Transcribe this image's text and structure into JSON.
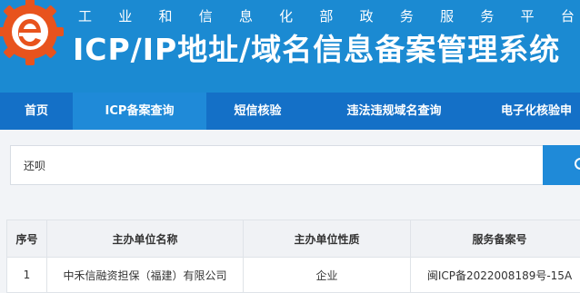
{
  "header": {
    "platform_name": [
      "工",
      "业",
      "和",
      "信",
      "息",
      "化",
      "部",
      "政",
      "务",
      "服",
      "务",
      "平",
      "台"
    ],
    "system_title": "ICP/IP地址/域名信息备案管理系统"
  },
  "nav": {
    "items": [
      {
        "label": "首页",
        "active": false
      },
      {
        "label": "ICP备案查询",
        "active": true
      },
      {
        "label": "短信核验",
        "active": false
      },
      {
        "label": "违法违规域名查询",
        "active": false
      },
      {
        "label": "电子化核验申",
        "active": false
      }
    ]
  },
  "search": {
    "value": "还呗",
    "button_icon": "search-icon"
  },
  "table": {
    "headers": [
      "序号",
      "主办单位名称",
      "主办单位性质",
      "服务备案号"
    ],
    "rows": [
      [
        "1",
        "中禾信融资担保（福建）有限公司",
        "企业",
        "闽ICP备2022008189号-15A"
      ]
    ]
  },
  "colors": {
    "header_bg": "#1b8ad2",
    "nav_bg": "#1470c7",
    "nav_active": "#1f8ad8",
    "logo_orange": "#e8531d"
  }
}
